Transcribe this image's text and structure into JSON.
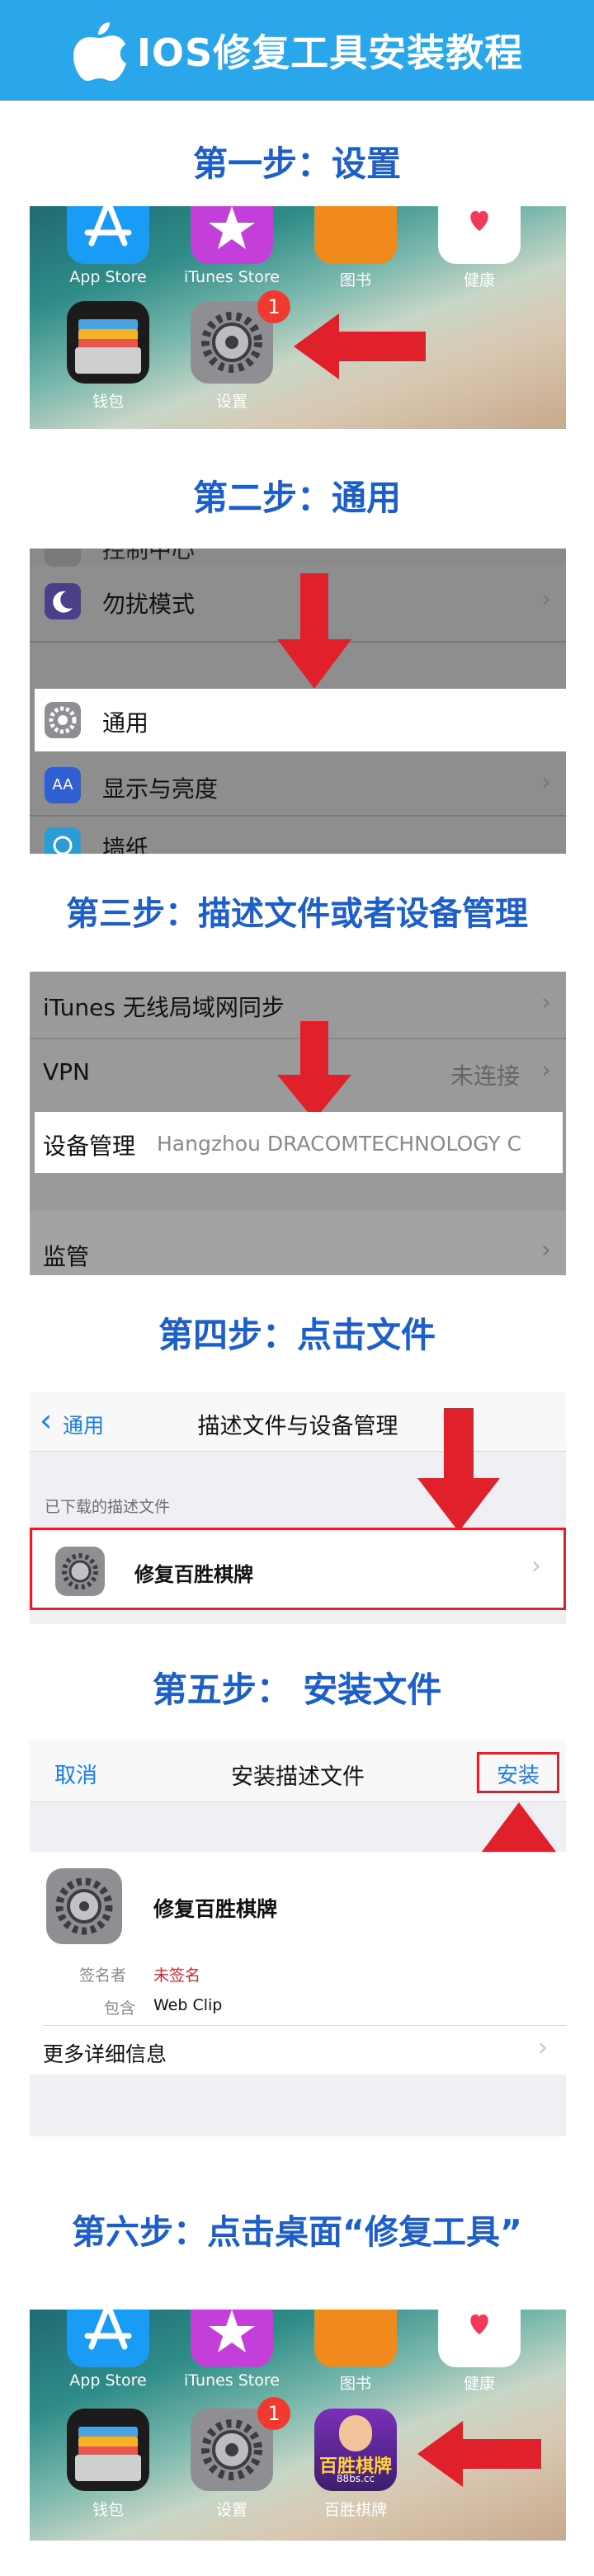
{
  "header": {
    "title": "IOS修复工具安装教程"
  },
  "steps": {
    "s1": "第一步：设置",
    "s2": "第二步：通用",
    "s3": "第三步：描述文件或者设备管理",
    "s4": "第四步：点击文件",
    "s5": "第五步： 安装文件",
    "s6": "第六步：点击桌面“修复工具”"
  },
  "home1": {
    "apps": [
      "App Store",
      "iTunes Store",
      "图书",
      "健康"
    ],
    "wallet": "钱包",
    "settings": "设置",
    "badge": "1"
  },
  "general": {
    "control_center": "控制中心",
    "dnd": "勿扰模式",
    "general": "通用",
    "display": "显示与亮度",
    "wallpaper": "墙纸",
    "aa_icon_text": "AA"
  },
  "device": {
    "itunes_wifi": "iTunes 无线局域网同步",
    "vpn": "VPN",
    "vpn_status": "未连接",
    "mgmt": "设备管理",
    "mgmt_value": "Hangzhou DRACOMTECHNOLOGY C",
    "supervision": "监管"
  },
  "profiles": {
    "back": "通用",
    "title": "描述文件与设备管理",
    "section": "已下载的描述文件",
    "item": "修复百胜棋牌"
  },
  "install": {
    "cancel": "取消",
    "title": "安装描述文件",
    "install": "安装",
    "name": "修复百胜棋牌",
    "signer_label": "签名者",
    "signer_value": "未签名",
    "contains_label": "包含",
    "contains_value": "Web Clip",
    "more": "更多详细信息"
  },
  "home2": {
    "apps": [
      "App Store",
      "iTunes Store",
      "图书",
      "健康"
    ],
    "wallet": "钱包",
    "settings": "设置",
    "badge": "1",
    "game": "百胜棋牌",
    "game_logo_text": "百胜棋牌",
    "game_logo_url": "88bs.cc"
  },
  "colors": {
    "accent_blue": "#1c5fcb",
    "header_blue": "#2aa7eb",
    "arrow_red": "#e0202a"
  }
}
